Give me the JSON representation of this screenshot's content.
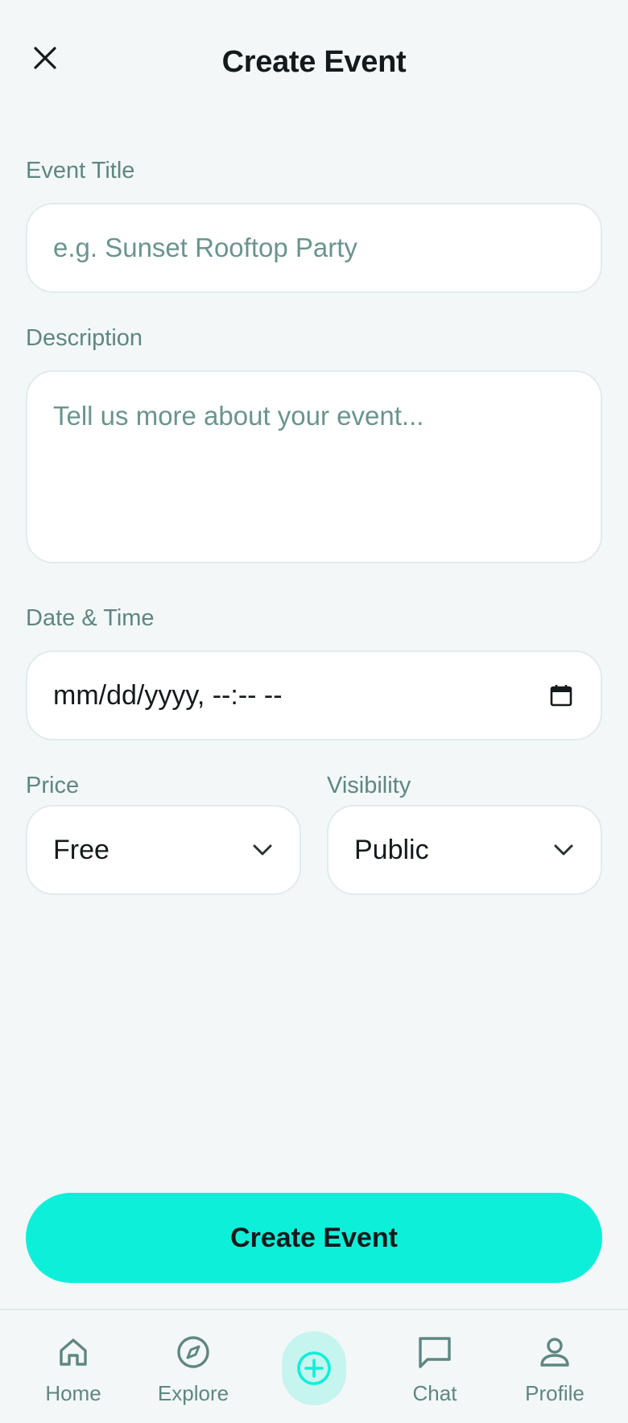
{
  "header": {
    "title": "Create Event",
    "close_icon": "close-icon"
  },
  "form": {
    "title_label": "Event Title",
    "title_placeholder": "e.g. Sunset Rooftop Party",
    "title_value": "",
    "description_label": "Description",
    "description_placeholder": "Tell us more about your event...",
    "description_value": "",
    "datetime_label": "Date & Time",
    "datetime_value": "mm/dd/yyyy, --:-- --",
    "price_label": "Price",
    "price_value": "Free",
    "visibility_label": "Visibility",
    "visibility_value": "Public"
  },
  "actions": {
    "submit_label": "Create Event"
  },
  "nav": {
    "items": [
      {
        "label": "Home",
        "icon": "home-icon"
      },
      {
        "label": "Explore",
        "icon": "compass-icon"
      },
      {
        "label": "",
        "icon": "add-circle-icon"
      },
      {
        "label": "Chat",
        "icon": "chat-icon"
      },
      {
        "label": "Profile",
        "icon": "user-icon"
      }
    ]
  },
  "colors": {
    "accent": "#0eefd9",
    "accent_soft": "#c6f4ef",
    "label": "#5e8780",
    "background": "#f3f7f8",
    "text": "#141a1b"
  }
}
